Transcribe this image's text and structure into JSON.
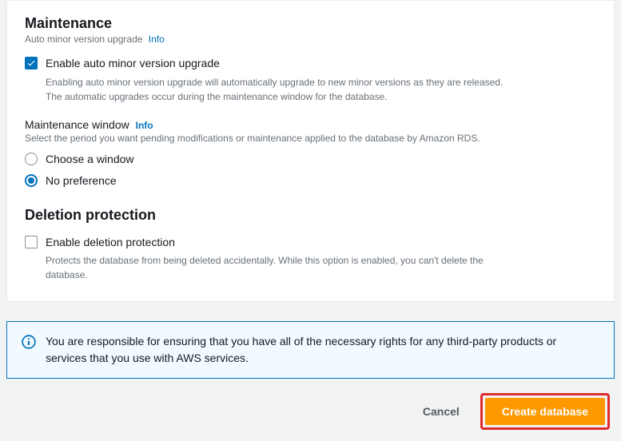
{
  "maintenance": {
    "title": "Maintenance",
    "subtitle": "Auto minor version upgrade",
    "info": "Info",
    "enable_label": "Enable auto minor version upgrade",
    "enable_desc": "Enabling auto minor version upgrade will automatically upgrade to new minor versions as they are released. The automatic upgrades occur during the maintenance window for the database.",
    "enable_checked": true,
    "window": {
      "label": "Maintenance window",
      "info": "Info",
      "desc": "Select the period you want pending modifications or maintenance applied to the database by Amazon RDS.",
      "options": [
        {
          "label": "Choose a window",
          "selected": false
        },
        {
          "label": "No preference",
          "selected": true
        }
      ]
    }
  },
  "deletion": {
    "title": "Deletion protection",
    "enable_label": "Enable deletion protection",
    "enable_desc": "Protects the database from being deleted accidentally. While this option is enabled, you can't delete the database.",
    "enable_checked": false
  },
  "notice": "You are responsible for ensuring that you have all of the necessary rights for any third-party products or services that you use with AWS services.",
  "footer": {
    "cancel": "Cancel",
    "create": "Create database"
  }
}
